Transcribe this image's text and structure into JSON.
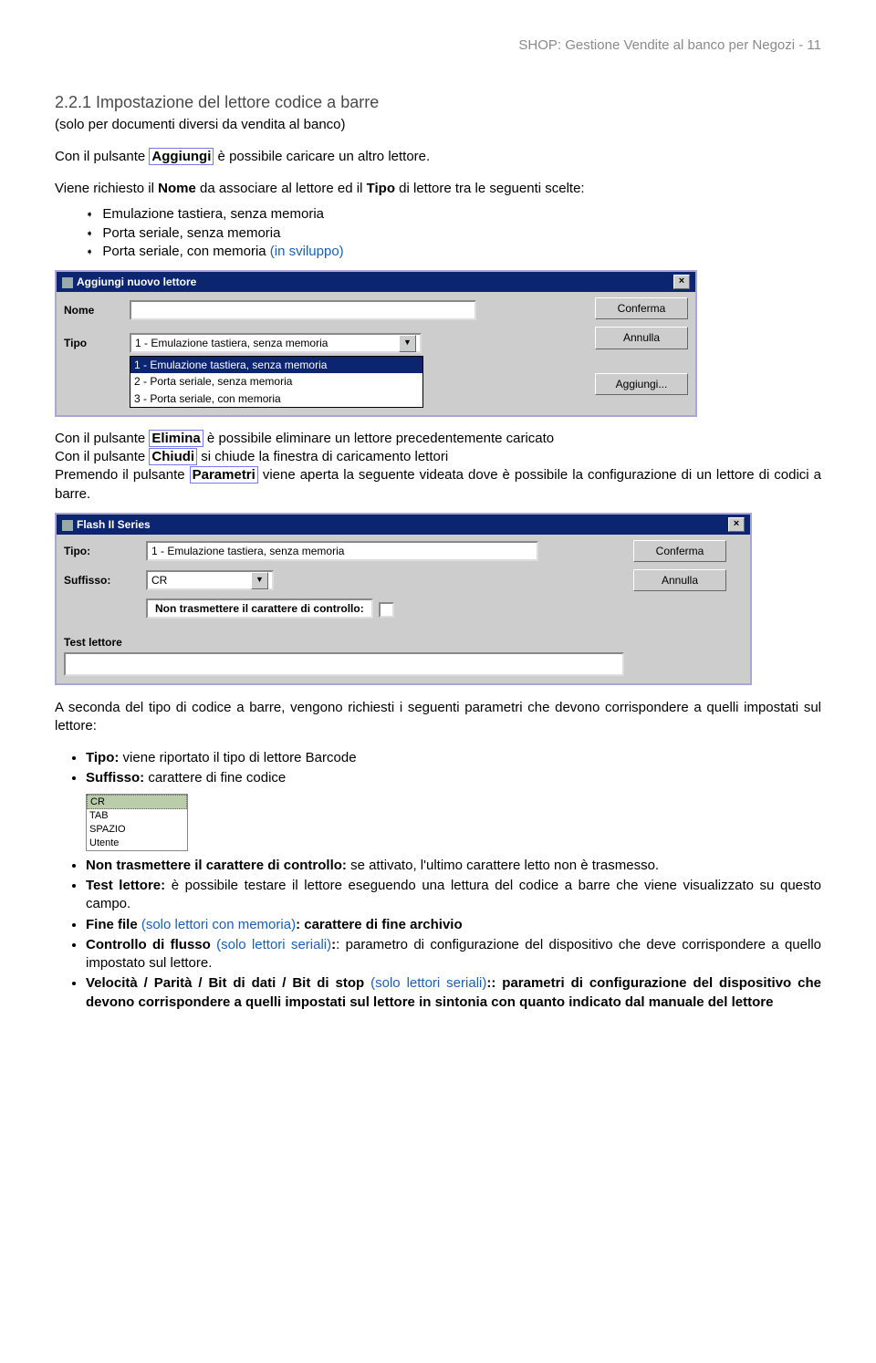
{
  "header": "SHOP: Gestione Vendite al banco per Negozi - 11",
  "sec": {
    "title": "2.2.1  Impostazione del lettore codice a barre",
    "sub": "(solo per documenti diversi da vendita al banco)"
  },
  "p1_a": "Con il pulsante ",
  "p1_btn": "Aggiungi",
  "p1_b": " è possibile caricare un altro lettore.",
  "p2_a": "Viene richiesto il ",
  "p2_b1": "Nome",
  "p2_c": " da associare al lettore ed il ",
  "p2_b2": "Tipo",
  "p2_d": " di lettore tra le seguenti scelte:",
  "opts": {
    "a": "Emulazione tastiera, senza memoria",
    "b": "Porta seriale, senza memoria",
    "c_a": "Porta seriale, con memoria ",
    "c_b": "(in sviluppo)"
  },
  "dlg1": {
    "title": "Aggiungi nuovo lettore",
    "label_nome": "Nome",
    "label_tipo": "Tipo",
    "combo_text": "1 - Emulazione tastiera, senza memoria",
    "dd1": "1 - Emulazione tastiera, senza memoria",
    "dd2": "2 - Porta seriale, senza memoria",
    "dd3": "3 - Porta seriale, con memoria",
    "btn_conferma": "Conferma",
    "btn_annulla": "Annulla",
    "btn_aggiungi": "Aggiungi..."
  },
  "mid": {
    "l1a": "Con il pulsante ",
    "l1b": "Elimina",
    "l1c": " è possibile eliminare un lettore precedentemente caricato",
    "l2a": "Con il pulsante ",
    "l2b": "Chiudi",
    "l2c": " si chiude la finestra di caricamento lettori",
    "l3a": "Premendo il pulsante ",
    "l3b": "Parametri",
    "l3c": " viene aperta la seguente videata dove è possibile la configurazione di un lettore di codici a barre."
  },
  "dlg2": {
    "title": "Flash II Series",
    "label_tipo": "Tipo:",
    "tipo_val": "1 - Emulazione tastiera, senza memoria",
    "label_suffisso": "Suffisso:",
    "suffisso_val": "CR",
    "chk_label": "Non trasmettere il carattere di controllo:",
    "label_test": "Test lettore",
    "btn_conferma": "Conferma",
    "btn_annulla": "Annulla"
  },
  "p3": "A seconda del tipo di codice a barre, vengono richiesti i seguenti parametri che devono corrispondere a quelli impostati sul lettore:",
  "bl": {
    "i1b": "Tipo:",
    "i1t": " viene riportato il tipo di lettore Barcode",
    "i2b": "Suffisso:",
    "i2t": " carattere di fine codice",
    "lst1": "CR",
    "lst2": "TAB",
    "lst3": "SPAZIO",
    "lst4": "Utente",
    "i3b": "Non trasmettere il carattere di controllo:",
    "i3t": " se attivato, l'ultimo carattere letto non è trasmesso.",
    "i4b": "Test lettore:",
    "i4t": " è possibile testare il lettore eseguendo una lettura del codice a barre che viene visualizzato su questo campo.",
    "i5b": "Fine file ",
    "i5n": "(solo lettori con memoria)",
    "i5t": ": carattere di fine archivio",
    "i6b": "Controllo di flusso ",
    "i6n": "(solo lettori seriali)",
    "i6t": ": parametro di configurazione del dispositivo che deve corrispondere a quello impostato sul lettore.",
    "i7b": "Velocità / Parità / Bit di dati / Bit di stop ",
    "i7n": "(solo lettori seriali)",
    "i7t": ":: parametri di configurazione del dispositivo che devono corrispondere a quelli impostati sul lettore in sintonia con quanto indicato dal manuale del lettore"
  }
}
